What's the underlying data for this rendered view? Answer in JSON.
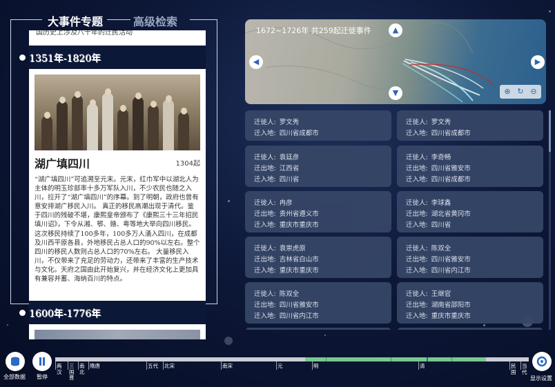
{
  "tabs": {
    "active": "大事件专题",
    "inactive": "高级检索"
  },
  "left_panel": {
    "clipped_text": "国历史上涉及八十年的迁民活动",
    "periods": [
      "1351年-1820年",
      "1600年-1776年"
    ],
    "event": {
      "title": "湖广填四川",
      "count": "1304起",
      "description": "“湖广填四川”可追溯至元末。元末，红巾军中以湖北人为主体的明玉珍部率十多万军队入川，不少农民也随之入川，拉开了“湖广填四川”的序幕。到了明朝，政府也曾有意安排湖广移民入川。 真正的移民高潮出现于清代。鉴于四川的残破不堪，康熙皇帝颁布了《康熙三十三年招民填川诏》，下令从湘、鄂、赣、粤等地大举向四川移民。这次移民持续了100多年，100多万人涌入四川，在成都及川西平原各县，外地移民占总人口的90%以左右。整个四川的移民人数则占总人口的70%左右。 大量移民入川，不仅带来了充足的劳动力，还带来了丰富的生产技术与文化。天府之国由此开始复兴，并在经济文化上更加具有兼容并蓄、海纳百川的特点。"
    }
  },
  "map": {
    "title": "1672~1726年  共259起迁徙事件",
    "icons": [
      "arrow-up-icon",
      "arrow-down-icon",
      "arrow-left-icon",
      "arrow-right-icon",
      "zoom-in-icon",
      "refresh-icon",
      "zoom-out-icon"
    ]
  },
  "labels": {
    "migrant": "迁徙人:",
    "from": "迁出地:",
    "to": "迁入地:"
  },
  "migrations": [
    {
      "migrant": "罗文秀",
      "to": "四川省成都市"
    },
    {
      "migrant": "罗文秀",
      "to": "四川省成都市"
    },
    {
      "migrant": "袁廷彦",
      "from": "江西省",
      "to": "四川省"
    },
    {
      "migrant": "李奇畅",
      "from": "四川省雅安市",
      "to": "四川省成都市"
    },
    {
      "migrant": "冉彦",
      "from": "贵州省遵义市",
      "to": "重庆市重庆市"
    },
    {
      "migrant": "李球鑫",
      "from": "湖北省黄冈市",
      "to": "四川省"
    },
    {
      "migrant": "袁崇虎原",
      "from": "吉林省白山市",
      "to": "重庆市重庆市"
    },
    {
      "migrant": "陈双全",
      "from": "四川省雅安市",
      "to": "四川省内江市"
    },
    {
      "migrant": "陈双全",
      "from": "四川省雅安市",
      "to": "四川省内江市"
    },
    {
      "migrant": "王继官",
      "from": "湖南省邵阳市",
      "to": "重庆市重庆市"
    }
  ],
  "controls": {
    "all_data": "全部数据",
    "pause": "暂停",
    "settings": "显示设置"
  },
  "timeline": [
    "两汉",
    "三国晋",
    "南北",
    "隋唐",
    "五代",
    "北宋",
    "南宋",
    "元",
    "明",
    "清",
    "民国",
    "当代"
  ],
  "colors": {
    "background": "#0d1838",
    "card": "#364667",
    "timeline_fill": "#77c98c",
    "accent": "#2d65b8"
  }
}
